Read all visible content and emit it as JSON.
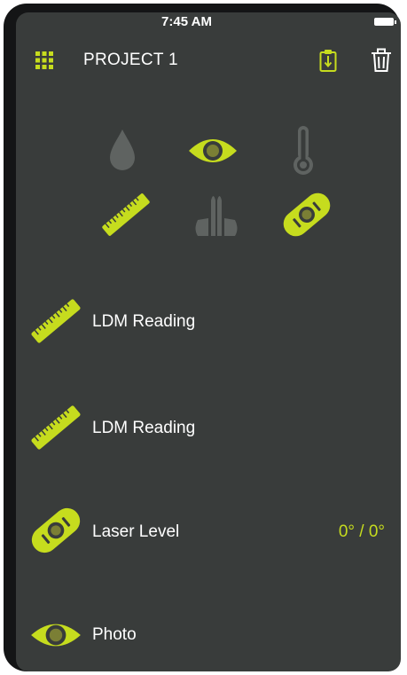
{
  "status_bar": {
    "time": "7:45 AM"
  },
  "header": {
    "title": "PROJECT 1",
    "menu_icon": "grid-icon",
    "export_icon": "clipboard-export-icon",
    "delete_icon": "trash-icon"
  },
  "tools": [
    {
      "name": "moisture",
      "icon": "drop-icon",
      "active": false
    },
    {
      "name": "camera",
      "icon": "eye-icon",
      "active": true
    },
    {
      "name": "temperature",
      "icon": "thermometer-icon",
      "active": false
    },
    {
      "name": "distance",
      "icon": "ruler-icon",
      "active": true
    },
    {
      "name": "stud-finder",
      "icon": "stud-finder-icon",
      "active": false
    },
    {
      "name": "level",
      "icon": "level-icon",
      "active": true
    }
  ],
  "entries": [
    {
      "label": "LDM Reading",
      "icon": "ruler-icon",
      "value": ""
    },
    {
      "label": "LDM Reading",
      "icon": "ruler-icon",
      "value": ""
    },
    {
      "label": "Laser Level",
      "icon": "level-icon",
      "value": "0° / 0°"
    },
    {
      "label": "Photo",
      "icon": "eye-icon",
      "value": ""
    }
  ],
  "colors": {
    "accent": "#c6dc1e",
    "background": "#393c3b",
    "inactive": "#5f6361",
    "frame": "#141516"
  }
}
